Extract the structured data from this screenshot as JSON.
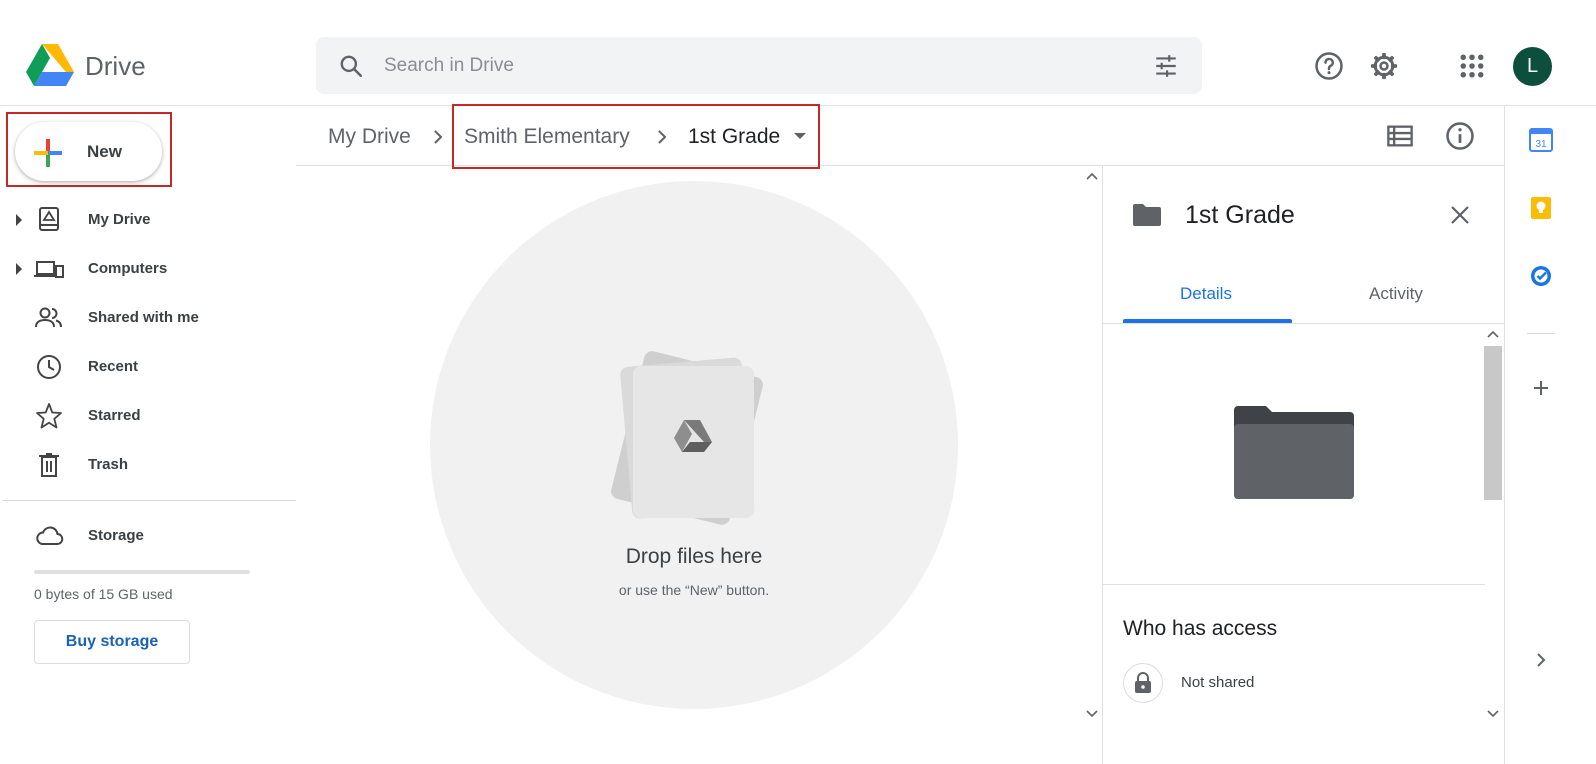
{
  "header": {
    "app_name": "Drive",
    "search_placeholder": "Search in Drive",
    "avatar_initial": "L"
  },
  "sidebar": {
    "new_label": "New",
    "items": [
      {
        "label": "My Drive",
        "icon": "my-drive-icon",
        "expandable": true
      },
      {
        "label": "Computers",
        "icon": "computers-icon",
        "expandable": true
      },
      {
        "label": "Shared with me",
        "icon": "shared-icon",
        "expandable": false
      },
      {
        "label": "Recent",
        "icon": "clock-icon",
        "expandable": false
      },
      {
        "label": "Starred",
        "icon": "star-icon",
        "expandable": false
      },
      {
        "label": "Trash",
        "icon": "trash-icon",
        "expandable": false
      }
    ],
    "storage_label": "Storage",
    "storage_used": "0 bytes of 15 GB used",
    "storage_fraction": 0,
    "buy_storage_label": "Buy storage"
  },
  "breadcrumb": {
    "items": [
      "My Drive",
      "Smith Elementary",
      "1st Grade"
    ]
  },
  "main": {
    "drop_title": "Drop files here",
    "drop_subtitle": "or use the “New” button."
  },
  "details": {
    "title": "1st Grade",
    "tabs": [
      "Details",
      "Activity"
    ],
    "active_tab": "Details",
    "access_title": "Who has access",
    "access_status": "Not shared"
  },
  "colors": {
    "accent": "#1a73e8",
    "highlight": "#c62828",
    "avatar": "#0d4f3d"
  }
}
